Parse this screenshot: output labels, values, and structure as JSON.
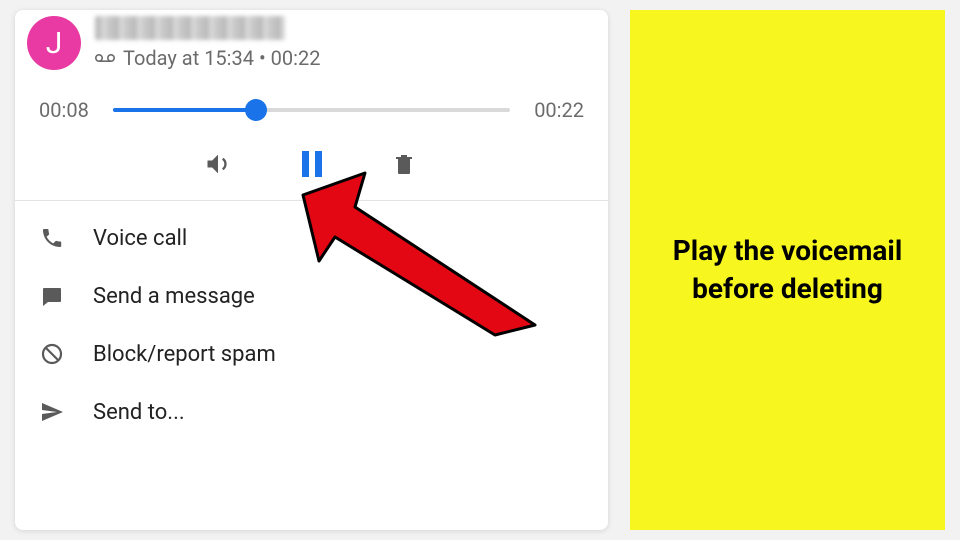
{
  "header": {
    "avatar_initial": "J",
    "meta": "Today at 15:34 • 00:22"
  },
  "player": {
    "elapsed": "00:08",
    "total": "00:22"
  },
  "options": {
    "voice_call": "Voice call",
    "send_message": "Send a message",
    "block_spam": "Block/report spam",
    "send_to": "Send to..."
  },
  "callout": {
    "text": "Play the voicemail before deleting"
  }
}
